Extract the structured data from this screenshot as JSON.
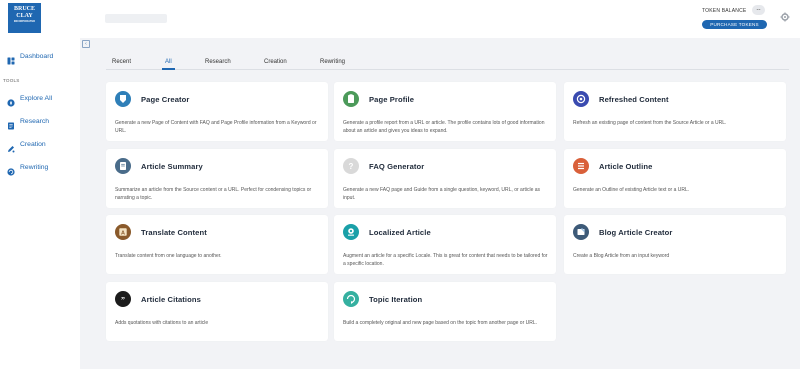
{
  "header": {
    "logo_line1": "BRUCE",
    "logo_line2": "CLAY",
    "logo_line3": "INCORPORATED",
    "token_label": "TOKEN BALANCE",
    "token_value": "--",
    "purchase_label": "PURCHASE TOKENS"
  },
  "sidebar": {
    "dashboard": "Dashboard",
    "tools_label": "TOOLS",
    "items": [
      {
        "label": "Explore All",
        "icon": "compass-icon"
      },
      {
        "label": "Research",
        "icon": "document-icon"
      },
      {
        "label": "Creation",
        "icon": "pen-icon"
      },
      {
        "label": "Rewriting",
        "icon": "refresh-icon"
      }
    ]
  },
  "tabs": [
    "Recent",
    "All",
    "Research",
    "Creation",
    "Rewriting"
  ],
  "active_tab": "All",
  "cards": [
    {
      "title": "Page Creator",
      "desc": "Generate a new Page of Content with FAQ and Page Profile information from a Keyword or URL.",
      "icon": "badge-icon",
      "color": "#2f7fb8"
    },
    {
      "title": "Page Profile",
      "desc": "Generate a profile report from a URL or article. The profile contains lots of good information about an article and gives you ideas to expand.",
      "icon": "clipboard-icon",
      "color": "#4c9a5a"
    },
    {
      "title": "Refreshed Content",
      "desc": "Refresh an existing page of content from the Source Article or a URL.",
      "icon": "target-icon",
      "color": "#3a4bb0"
    },
    {
      "title": "Article Summary",
      "desc": "Summarize an article from the Source content or a URL. Perfect for condensing topics or narrating a topic.",
      "icon": "summary-icon",
      "color": "#4a6c8a"
    },
    {
      "title": "FAQ Generator",
      "desc": "Generate a new FAQ page and Guide from a single question, keyword, URL, or article as input.",
      "icon": "question-icon",
      "color": "#d9d9d9"
    },
    {
      "title": "Article Outline",
      "desc": "Generate an Outline of existing Article text or a URL.",
      "icon": "list-icon",
      "color": "#d9603a"
    },
    {
      "title": "Translate Content",
      "desc": "Translate content from one language to another.",
      "icon": "translate-icon",
      "color": "#8a5a2b"
    },
    {
      "title": "Localized Article",
      "desc": "Augment an article for a specific Locale. This is great for content that needs to be tailored for a specific location.",
      "icon": "location-icon",
      "color": "#1aa0a8"
    },
    {
      "title": "Blog Article Creator",
      "desc": "Create a Blog Article from an input keyword",
      "icon": "blog-icon",
      "color": "#3d5a78"
    },
    {
      "title": "Article Citations",
      "desc": "Adds quotations with citations to an article",
      "icon": "quote-icon",
      "color": "#1c1c1c"
    },
    {
      "title": "Topic Iteration",
      "desc": "Build a completely original and new page based on the topic from another page or URL.",
      "icon": "iteration-icon",
      "color": "#35b0a0"
    }
  ]
}
